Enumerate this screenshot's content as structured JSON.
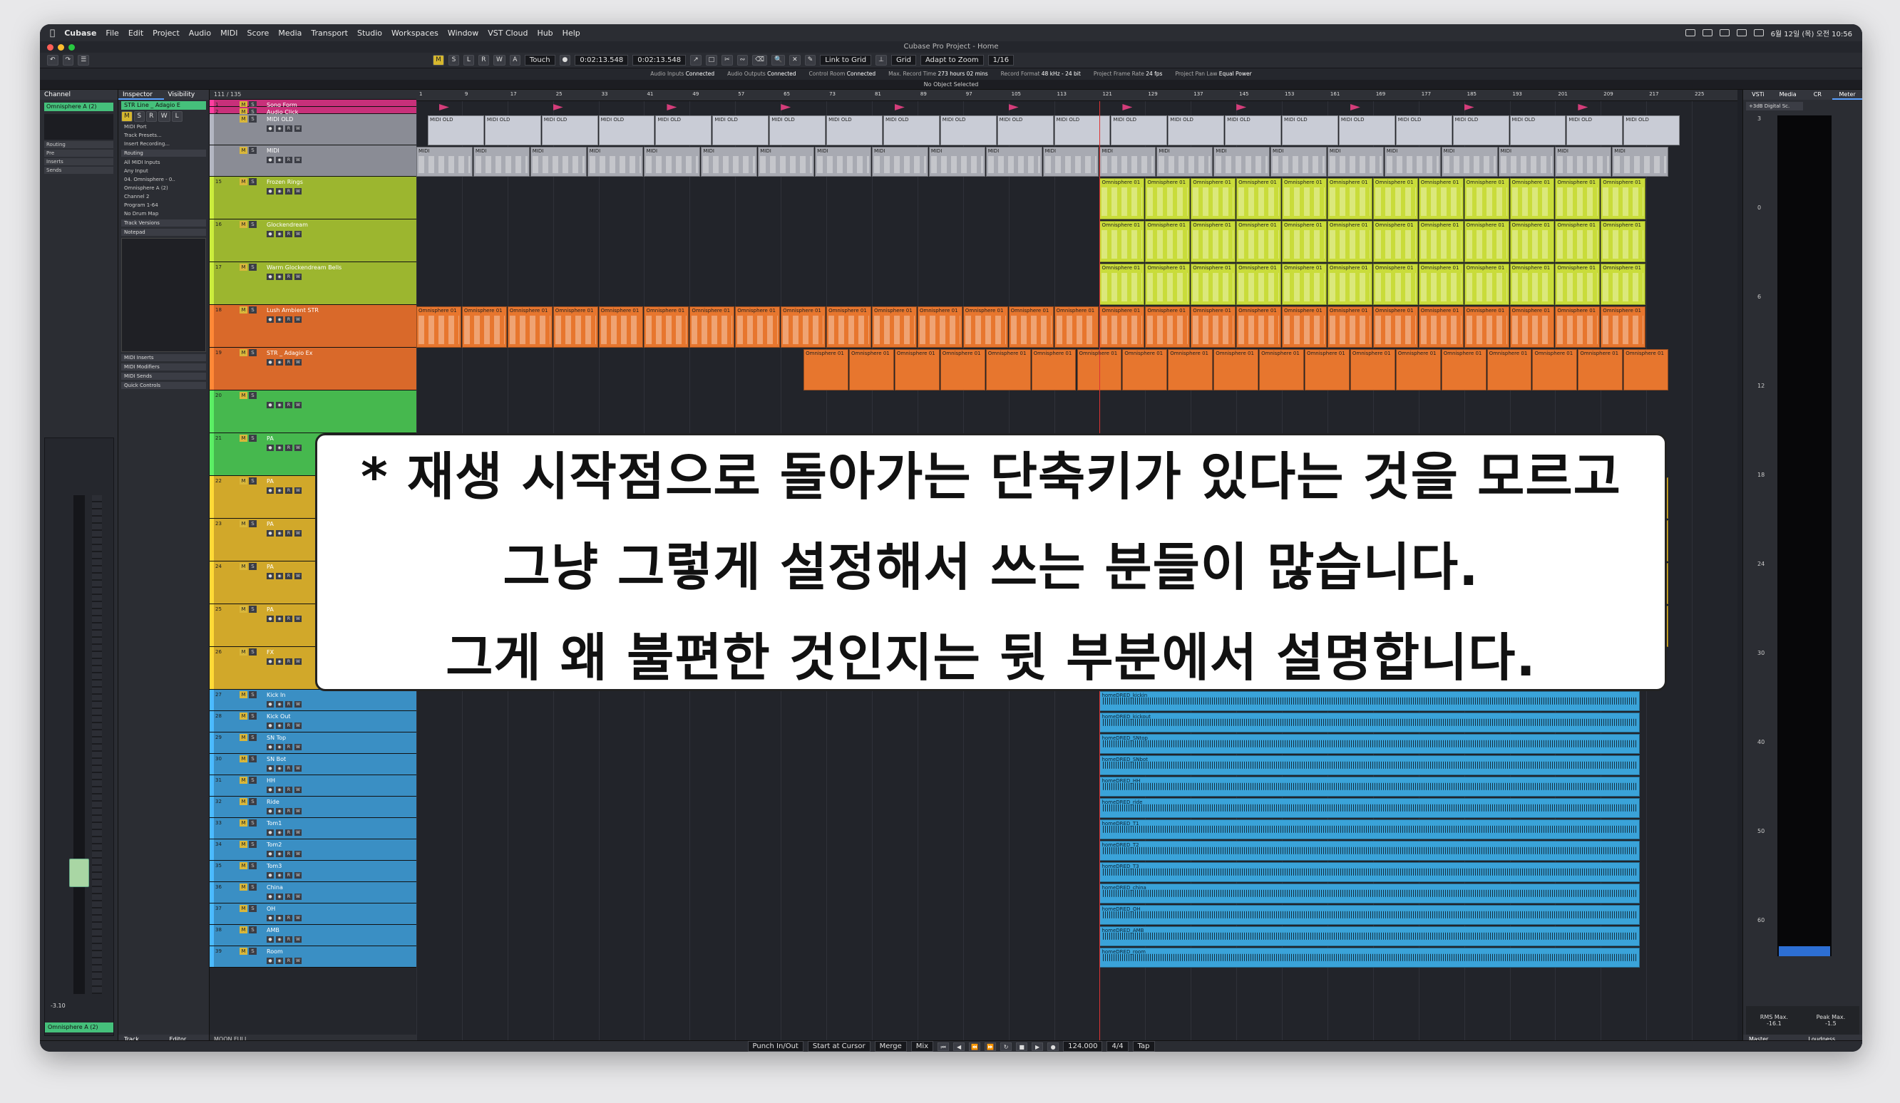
{
  "menubar": {
    "app": "Cubase",
    "items": [
      "File",
      "Edit",
      "Project",
      "Audio",
      "MIDI",
      "Score",
      "Media",
      "Transport",
      "Studio",
      "Workspaces",
      "Window",
      "VST Cloud",
      "Hub",
      "Help"
    ],
    "clock": "6월 12일 (목) 오전 10:56"
  },
  "window_title": "Cubase Pro Project - Home",
  "toolbar": {
    "automation_mode": "Touch",
    "time_left": "0:02:13.548",
    "time_right": "0:02:13.548",
    "link_to_grid": "Link to Grid",
    "grid": "Grid",
    "adapt_to_zoom": "Adapt to Zoom",
    "quantize": "1/16"
  },
  "status": [
    {
      "label": "Audio Inputs",
      "value": "Connected"
    },
    {
      "label": "Audio Outputs",
      "value": "Connected"
    },
    {
      "label": "Control Room",
      "value": "Connected"
    },
    {
      "label": "Max. Record Time",
      "value": "273 hours 02 mins"
    },
    {
      "label": "Record Format",
      "value": "48 kHz - 24 bit"
    },
    {
      "label": "Project Frame Rate",
      "value": "24 fps"
    },
    {
      "label": "Project Pan Law",
      "value": "Equal Power"
    }
  ],
  "info_line": "No Object Selected",
  "left_zone": {
    "tab": "Channel",
    "channel": "Omnisphere A (2)",
    "sections": [
      "Routing",
      "Pre",
      "Inserts",
      "Sends"
    ],
    "fader_value": "-3.10",
    "footer_channel": "Omnisphere A (2)"
  },
  "inspector": {
    "tabs": [
      "Inspector",
      "Visibility"
    ],
    "track": "STR Line _ Adagio E",
    "rows": [
      "MIDI Port",
      "Track Presets...",
      "Insert Recording...",
      "Routing",
      "All MIDI Inputs",
      "Any Input",
      "04. Omnisphere - 0..",
      "Omnisphere A (2)",
      "Channel 2",
      "Program 1-64",
      "No Drum Map",
      "Track Versions",
      "Notepad",
      "MIDI Inserts",
      "MIDI Modifiers",
      "MIDI Sends",
      "Quick Controls"
    ],
    "bottom_tabs": [
      "Track",
      "Editor"
    ]
  },
  "tracklist": {
    "header": "111 / 135",
    "footer": "MOON FULL",
    "tracks": [
      {
        "num": "1",
        "name": "Song Form",
        "color": "#c8307a"
      },
      {
        "num": "2",
        "name": "Audio Click",
        "color": "#c8307a"
      },
      {
        "num": "",
        "name": "MIDI OLD",
        "color": "#8a8c95"
      },
      {
        "num": "",
        "name": "MIDI",
        "color": "#8a8c95"
      },
      {
        "num": "15",
        "name": "Frozen Rings",
        "color": "#9cb62f"
      },
      {
        "num": "16",
        "name": "Glockendream",
        "color": "#9cb62f"
      },
      {
        "num": "17",
        "name": "Warm Glockendream Bells",
        "color": "#9cb62f"
      },
      {
        "num": "18",
        "name": "Lush Ambient STR",
        "color": "#d9692a"
      },
      {
        "num": "19",
        "name": "STR _ Adagio Ex",
        "color": "#d9692a"
      },
      {
        "num": "20",
        "name": "",
        "color": "#46b84e"
      },
      {
        "num": "21",
        "name": "PA",
        "color": "#46b84e"
      },
      {
        "num": "22",
        "name": "PA",
        "color": "#d1a82a"
      },
      {
        "num": "23",
        "name": "PA",
        "color": "#d1a82a"
      },
      {
        "num": "24",
        "name": "PA",
        "color": "#d1a82a"
      },
      {
        "num": "25",
        "name": "PA",
        "color": "#d1a82a"
      },
      {
        "num": "26",
        "name": "FX",
        "color": "#d1a82a"
      },
      {
        "num": "27",
        "name": "Kick In",
        "color": "#3a8fc4"
      },
      {
        "num": "28",
        "name": "Kick Out",
        "color": "#3a8fc4"
      },
      {
        "num": "29",
        "name": "SN Top",
        "color": "#3a8fc4"
      },
      {
        "num": "30",
        "name": "SN Bot",
        "color": "#3a8fc4"
      },
      {
        "num": "31",
        "name": "HH",
        "color": "#3a8fc4"
      },
      {
        "num": "32",
        "name": "Ride",
        "color": "#3a8fc4"
      },
      {
        "num": "33",
        "name": "Tom1",
        "color": "#3a8fc4"
      },
      {
        "num": "34",
        "name": "Tom2",
        "color": "#3a8fc4"
      },
      {
        "num": "35",
        "name": "Tom3",
        "color": "#3a8fc4"
      },
      {
        "num": "36",
        "name": "China",
        "color": "#3a8fc4"
      },
      {
        "num": "37",
        "name": "OH",
        "color": "#3a8fc4"
      },
      {
        "num": "38",
        "name": "AMB",
        "color": "#3a8fc4"
      },
      {
        "num": "39",
        "name": "Room",
        "color": "#3a8fc4"
      }
    ]
  },
  "ruler_marks": [
    "1",
    "9",
    "17",
    "25",
    "33",
    "41",
    "49",
    "57",
    "65",
    "73",
    "81",
    "89",
    "97",
    "105",
    "113",
    "121",
    "129",
    "137",
    "145",
    "153",
    "161",
    "169",
    "177",
    "185",
    "193",
    "201",
    "209",
    "217",
    "225"
  ],
  "clips": {
    "midi_old": "MIDI OLD",
    "midi": "MIDI",
    "omni": "Omnisphere 01",
    "fx": "FX",
    "audio": [
      "homeDRED_kickin",
      "homeDRED_kickout",
      "homeDRED_SNtop",
      "homeDRED_SNbot",
      "homeDRED_HH",
      "homeDRED_ride",
      "homeDRED_T1",
      "homeDRED_T2",
      "homeDRED_T3",
      "homeDRED_china",
      "homeDRED_OH",
      "homeDRED_AMB",
      "homeDRED_room"
    ]
  },
  "right_zone": {
    "tabs": [
      "VSTi",
      "Media",
      "CR",
      "Meter"
    ],
    "preset": "+3dB Digital Sc.",
    "scale": [
      "3",
      "0",
      "6",
      "12",
      "18",
      "24",
      "30",
      "40",
      "50",
      "60"
    ],
    "rms_label": "RMS Max.",
    "rms": "-16.1",
    "peak_label": "Peak Max.",
    "peak": "-1.5",
    "bottom_tabs": [
      "Master",
      "Loudness"
    ]
  },
  "transport": {
    "punch": "Punch In/Out",
    "start": "Start at Cursor",
    "merge": "Merge",
    "mix": "Mix",
    "tempo": "124.000",
    "signature": "4/4",
    "tap": "Tap"
  },
  "overlay": {
    "line1": "* 재생 시작점으로 돌아가는 단축키가 있다는 것을 모르고",
    "line2": "그냥 그렇게 설정해서 쓰는 분들이 많습니다.",
    "line3": "그게 왜 불편한 것인지는 뒷 부분에서 설명합니다."
  }
}
